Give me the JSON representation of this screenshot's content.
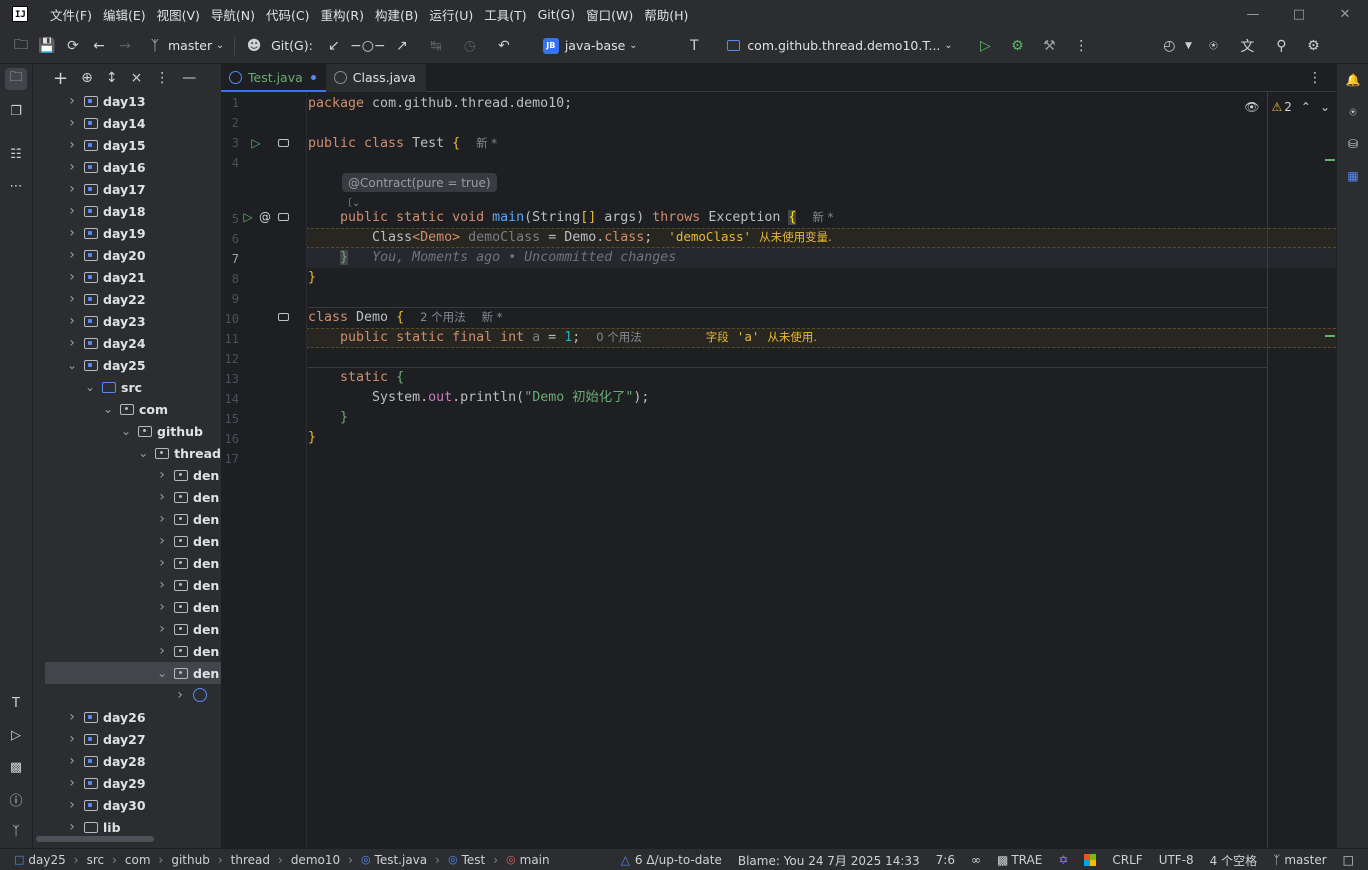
{
  "menubar": {
    "items": [
      "文件(F)",
      "编辑(E)",
      "视图(V)",
      "导航(N)",
      "代码(C)",
      "重构(R)",
      "构建(B)",
      "运行(U)",
      "工具(T)",
      "Git(G)",
      "窗口(W)",
      "帮助(H)"
    ],
    "logo_text": "IJ"
  },
  "toolbar": {
    "branch": "master",
    "git_label": "Git(G):",
    "project_badge": "JB",
    "project": "java-base",
    "run_config": "com.github.thread.demo10.T..."
  },
  "project_tree": [
    {
      "label": "day13",
      "type": "module"
    },
    {
      "label": "day14",
      "type": "module"
    },
    {
      "label": "day15",
      "type": "module"
    },
    {
      "label": "day16",
      "type": "module"
    },
    {
      "label": "day17",
      "type": "module"
    },
    {
      "label": "day18",
      "type": "module"
    },
    {
      "label": "day19",
      "type": "module"
    },
    {
      "label": "day20",
      "type": "module"
    },
    {
      "label": "day21",
      "type": "module"
    },
    {
      "label": "day22",
      "type": "module"
    },
    {
      "label": "day23",
      "type": "module"
    },
    {
      "label": "day24",
      "type": "module"
    },
    {
      "label": "day25",
      "type": "module"
    },
    {
      "label": "src",
      "type": "src"
    },
    {
      "label": "com",
      "type": "pkg"
    },
    {
      "label": "github",
      "type": "pkg"
    },
    {
      "label": "thread",
      "type": "pkg"
    },
    {
      "label": "den",
      "type": "pkg"
    },
    {
      "label": "den",
      "type": "pkg"
    },
    {
      "label": "den",
      "type": "pkg"
    },
    {
      "label": "den",
      "type": "pkg"
    },
    {
      "label": "den",
      "type": "pkg"
    },
    {
      "label": "den",
      "type": "pkg"
    },
    {
      "label": "den",
      "type": "pkg"
    },
    {
      "label": "den",
      "type": "pkg"
    },
    {
      "label": "den",
      "type": "pkg"
    },
    {
      "label": "den",
      "type": "pkg"
    },
    {
      "label": "",
      "type": "class"
    },
    {
      "label": "day26",
      "type": "module"
    },
    {
      "label": "day27",
      "type": "module"
    },
    {
      "label": "day28",
      "type": "module"
    },
    {
      "label": "day29",
      "type": "module"
    },
    {
      "label": "day30",
      "type": "module"
    },
    {
      "label": "lib",
      "type": "folder"
    }
  ],
  "tabs": [
    {
      "label": "Test.java",
      "active": true,
      "modified": true
    },
    {
      "label": "Class.java",
      "active": false
    }
  ],
  "editor": {
    "line_numbers": [
      "1",
      "2",
      "3",
      "4",
      "5",
      "6",
      "7",
      "8",
      "9",
      "10",
      "11",
      "12",
      "13",
      "14",
      "15",
      "16",
      "17"
    ],
    "warnings_count": "2",
    "contract_hint": "@Contract(pure = true)",
    "code": {
      "l1_kw": "package",
      "l1_rest": " com.github.thread.demo10;",
      "l3_kw": "public class",
      "l3_name": " Test ",
      "l3_brace": "{",
      "l3_hint": "新 *",
      "l5_kw": "public static void",
      "l5_fn": " main",
      "l5_args_a": "(String",
      "l5_args_b": "[]",
      "l5_args_c": " args) ",
      "l5_throws": "throws",
      "l5_exc": " Exception ",
      "l5_brace": "{",
      "l5_hint": "新 *",
      "l6_a": "Class",
      "l6_b": "<Demo>",
      "l6_var": " demoClass",
      "l6_c": " = Demo.",
      "l6_kw": "class",
      "l6_d": ";",
      "l6_warn_code": "'demoClass'",
      "l6_warn_text": "从未使用变量.",
      "l7_brace": "}",
      "l7_blame": "You, Moments ago • Uncommitted changes",
      "l8_brace": "}",
      "l10_kw": "class",
      "l10_name": " Demo ",
      "l10_brace": "{",
      "l10_usage": "2 个用法",
      "l10_hint": "新 *",
      "l11_kw": "public static final int",
      "l11_fld": " a",
      "l11_eq": " = ",
      "l11_num": "1",
      "l11_semi": ";",
      "l11_usage": "0 个用法",
      "l11_warn_text_a": "字段",
      "l11_warn_code": "'a'",
      "l11_warn_text_b": "从未使用.",
      "l13_kw": "static",
      "l13_brace": " {",
      "l14_a": "System.",
      "l14_fld": "out",
      "l14_b": ".println(",
      "l14_str": "\"Demo 初始化了\"",
      "l14_c": ");",
      "l15_brace": "}",
      "l16_brace": "}"
    }
  },
  "statusbar": {
    "breadcrumbs": [
      "day25",
      "src",
      "com",
      "github",
      "thread",
      "demo10",
      "Test.java",
      "Test",
      "main"
    ],
    "vcs": "6 Δ/up-to-date",
    "blame": "Blame: You 24 7月 2025 14:33",
    "position": "7:6",
    "trae": "TRAE",
    "line_sep": "CRLF",
    "encoding": "UTF-8",
    "indent": "4 个空格",
    "branch": "master"
  },
  "colors": {
    "accent": "#3574f0",
    "keyword": "#cf8e6d",
    "function": "#56a8f5",
    "string": "#6aab73",
    "warning": "#e8ba36"
  }
}
